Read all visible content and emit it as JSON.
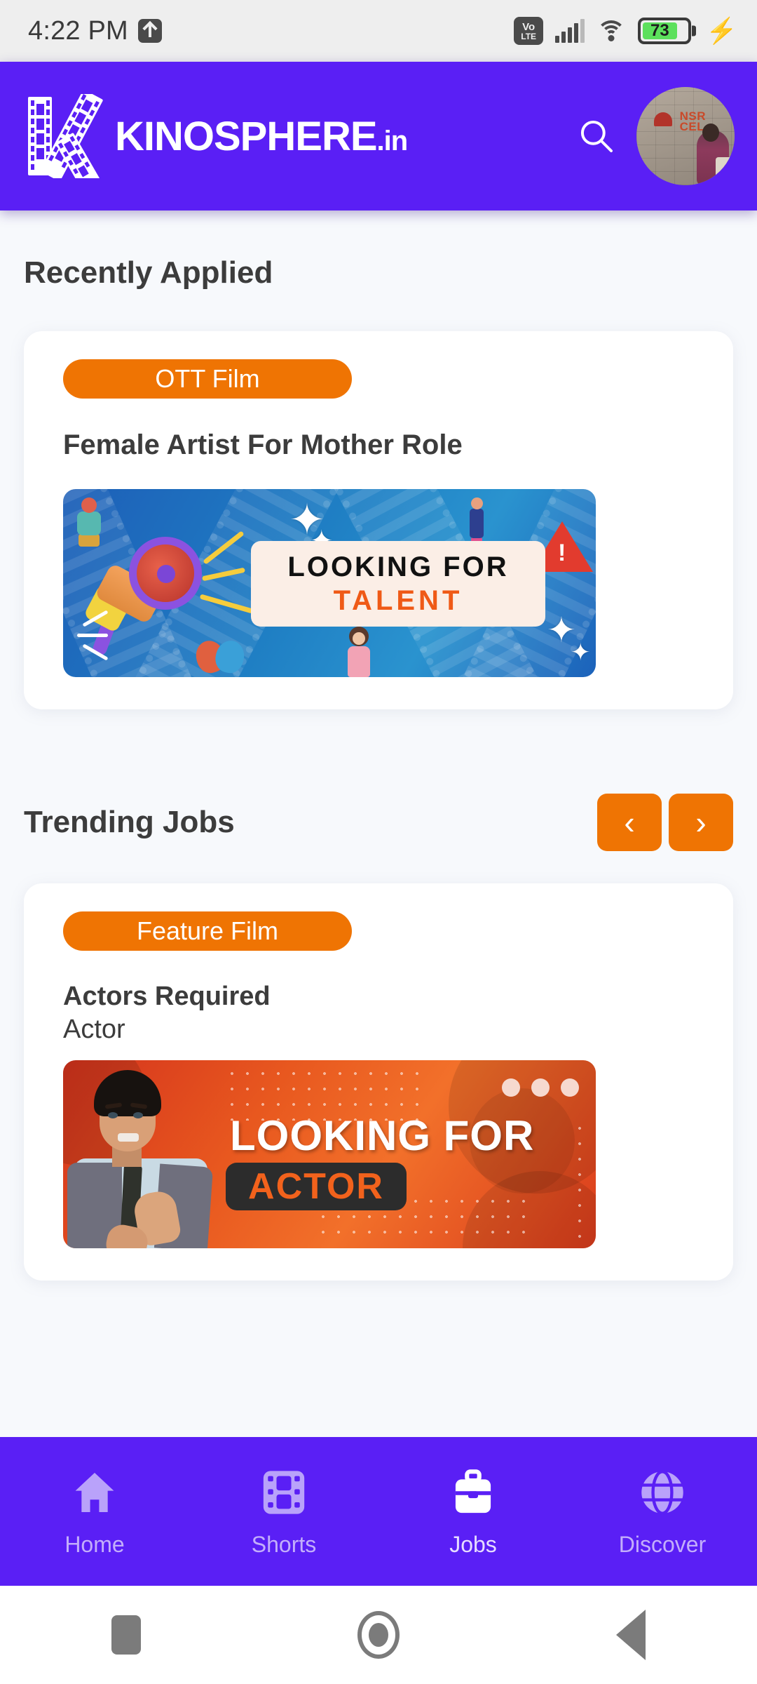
{
  "status_bar": {
    "time": "4:22 PM",
    "upload_icon": "upload-indicator-icon",
    "volte_top": "Vo",
    "volte_bottom": "LTE",
    "signal_icon": "cellular-signal-icon",
    "wifi_icon": "wifi-icon",
    "battery_percent": "73",
    "charging_icon": "charging-bolt-icon"
  },
  "app_bar": {
    "brand_name": "KINOSPHERE",
    "brand_tld": ".in",
    "logo_icon": "film-strip-k-logo-icon",
    "search_icon": "search-icon",
    "avatar_icon": "profile-avatar",
    "avatar_sign_text": "NSR\nCEL",
    "background_color": "#5a1ff5"
  },
  "sections": [
    {
      "title": "Recently Applied",
      "has_arrows": false,
      "card": {
        "badge": "OTT Film",
        "title": "Female Artist For Mother Role",
        "subtitle": "",
        "banner": {
          "style": "blue",
          "line1": "LOOKING FOR",
          "line2": "TALENT",
          "megaphone_icon": "megaphone-icon",
          "warning_icon": "warning-triangle-icon"
        }
      }
    },
    {
      "title": "Trending Jobs",
      "has_arrows": true,
      "prev_label": "‹",
      "next_label": "›",
      "card": {
        "badge": "Feature Film",
        "title": "Actors Required",
        "subtitle": "Actor",
        "banner": {
          "style": "orange",
          "line1": "LOOKING FOR",
          "line2": "ACTOR",
          "person_icon": "actor-portrait-icon"
        }
      }
    }
  ],
  "bottom_nav": {
    "items": [
      {
        "label": "Home",
        "icon": "home-icon",
        "active": false
      },
      {
        "label": "Shorts",
        "icon": "film-strip-icon",
        "active": false
      },
      {
        "label": "Jobs",
        "icon": "briefcase-icon",
        "active": true
      },
      {
        "label": "Discover",
        "icon": "globe-icon",
        "active": false
      }
    ],
    "background_color": "#5a1ff5"
  },
  "android_nav": {
    "recents_icon": "recents-square-icon",
    "home_icon": "home-circle-icon",
    "back_icon": "back-triangle-icon"
  },
  "colors": {
    "brand_purple": "#5a1ff5",
    "accent_orange": "#ef7403",
    "page_background": "#f7f9fc",
    "card_background": "#ffffff",
    "text_dark": "#3c3c3c"
  }
}
